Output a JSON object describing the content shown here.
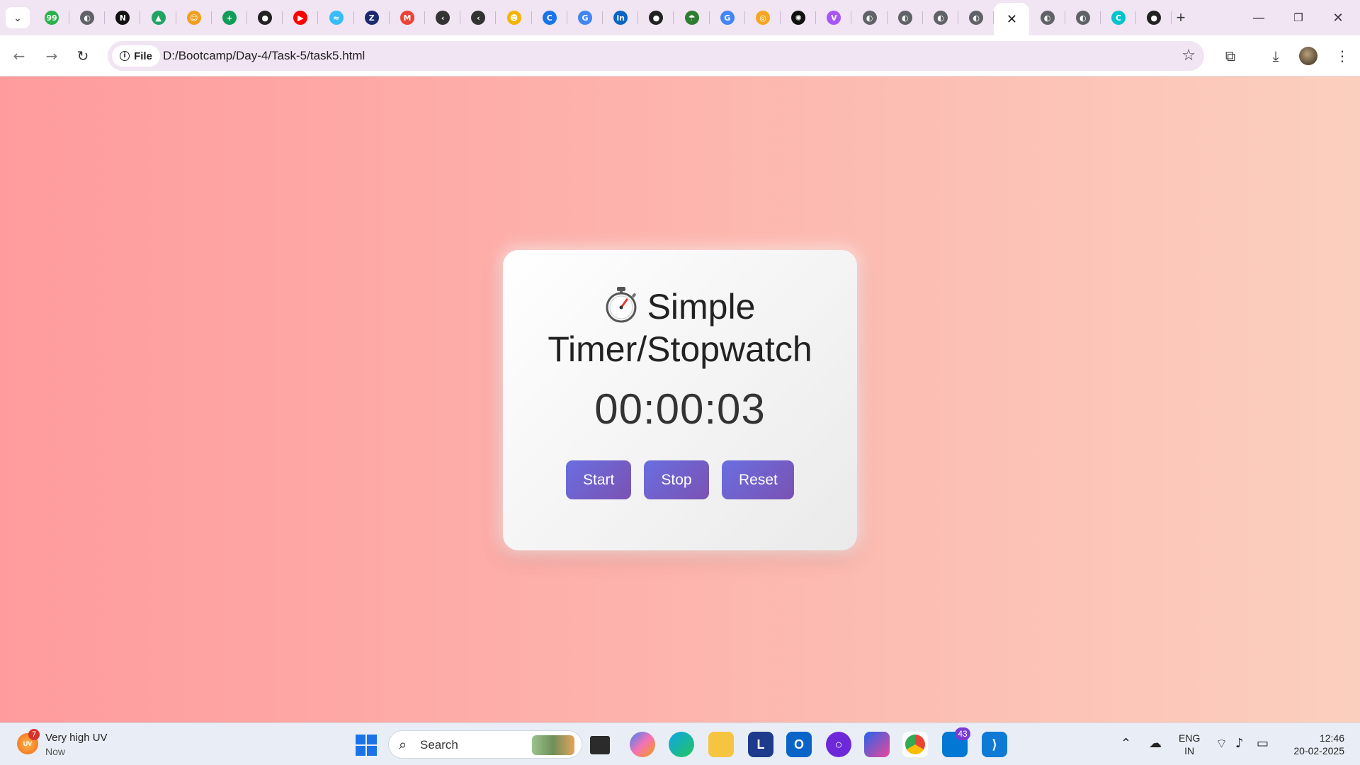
{
  "browser": {
    "tabs": [
      {
        "icon": "tab-list-icon",
        "color": "#ffffff",
        "glyph": "⌄"
      },
      {
        "icon": "green-counter-icon",
        "color": "#2bb24c",
        "glyph": "99"
      },
      {
        "icon": "globe-icon",
        "color": "#5f6368",
        "glyph": "◐"
      },
      {
        "icon": "notion-icon",
        "color": "#111111",
        "glyph": "N"
      },
      {
        "icon": "google-drive-icon",
        "color": "#1fa463",
        "glyph": "▲"
      },
      {
        "icon": "emoji-icon",
        "color": "#f0a020",
        "glyph": "☺"
      },
      {
        "icon": "sheets-plus-icon",
        "color": "#0f9d58",
        "glyph": "+"
      },
      {
        "icon": "github-icon",
        "color": "#222222",
        "glyph": "●"
      },
      {
        "icon": "youtube-icon",
        "color": "#ff0000",
        "glyph": "▶"
      },
      {
        "icon": "tailwind-icon",
        "color": "#38bdf8",
        "glyph": "≈"
      },
      {
        "icon": "zeo-icon",
        "color": "#1b2a6b",
        "glyph": "Z"
      },
      {
        "icon": "gmail-icon",
        "color": "#ea4335",
        "glyph": "M"
      },
      {
        "icon": "claude-icon",
        "color": "#333333",
        "glyph": "‹"
      },
      {
        "icon": "claude-icon",
        "color": "#333333",
        "glyph": "‹"
      },
      {
        "icon": "contacts-icon",
        "color": "#f4b400",
        "glyph": "☻"
      },
      {
        "icon": "canva-icon",
        "color": "#1a73e8",
        "glyph": "C"
      },
      {
        "icon": "google-icon",
        "color": "#4285f4",
        "glyph": "G"
      },
      {
        "icon": "linkedin-icon",
        "color": "#0a66c2",
        "glyph": "in"
      },
      {
        "icon": "github-icon",
        "color": "#222222",
        "glyph": "●"
      },
      {
        "icon": "umbrella-icon",
        "color": "#2e7d32",
        "glyph": "☂"
      },
      {
        "icon": "google-icon",
        "color": "#4285f4",
        "glyph": "G"
      },
      {
        "icon": "cookie-icon",
        "color": "#f5a623",
        "glyph": "◎"
      },
      {
        "icon": "openai-icon",
        "color": "#111111",
        "glyph": "✺"
      },
      {
        "icon": "vite-icon",
        "color": "#a855f7",
        "glyph": "V"
      },
      {
        "icon": "globe-icon",
        "color": "#5f6368",
        "glyph": "◐"
      },
      {
        "icon": "globe-icon",
        "color": "#5f6368",
        "glyph": "◐"
      },
      {
        "icon": "globe-icon",
        "color": "#5f6368",
        "glyph": "◐"
      },
      {
        "icon": "globe-icon",
        "color": "#5f6368",
        "glyph": "◐"
      },
      {
        "icon": "close-icon",
        "color": "#222222",
        "glyph": "✕",
        "active": true
      },
      {
        "icon": "globe-icon",
        "color": "#5f6368",
        "glyph": "◐"
      },
      {
        "icon": "globe-icon",
        "color": "#5f6368",
        "glyph": "◐"
      },
      {
        "icon": "canva-icon",
        "color": "#00c4cc",
        "glyph": "C"
      },
      {
        "icon": "github-icon",
        "color": "#222222",
        "glyph": "●"
      }
    ],
    "site_chip": "File",
    "url": "D:/Bootcamp/Day-4/Task-5/task5.html"
  },
  "page": {
    "title": "Simple Timer/Stopwatch",
    "time": "00:00:03",
    "buttons": {
      "start": "Start",
      "stop": "Stop",
      "reset": "Reset"
    },
    "colors": {
      "bg_left": "#ff9b9d",
      "bg_right": "#fbcfbe",
      "button_from": "#6a6ee0",
      "button_to": "#7a52b3"
    }
  },
  "taskbar": {
    "weather_title": "Very high UV",
    "weather_sub": "Now",
    "uv_label": "UV",
    "uv_badge": "7",
    "search_label": "Search",
    "mail_badge": "43",
    "lang_top": "ENG",
    "lang_bottom": "IN",
    "time": "12:46",
    "date": "20-02-2025"
  }
}
